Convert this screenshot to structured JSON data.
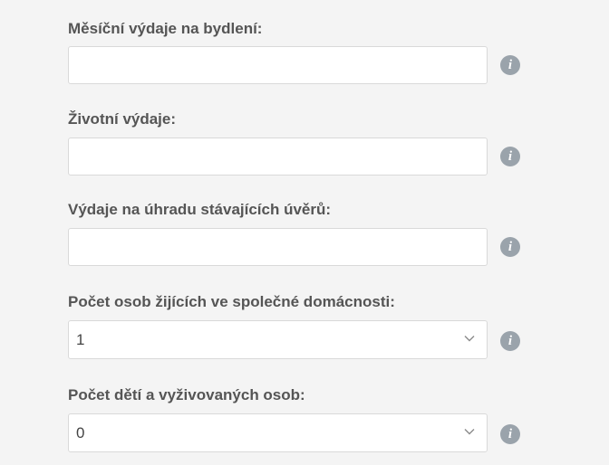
{
  "fields": [
    {
      "label": "Měsíční výdaje na bydlení:",
      "type": "text",
      "value": "",
      "info_icon": "info-icon"
    },
    {
      "label": "Životní výdaje:",
      "type": "text",
      "value": "",
      "info_icon": "info-icon"
    },
    {
      "label": "Výdaje na úhradu stávajících úvěrů:",
      "type": "text",
      "value": "",
      "info_icon": "info-icon"
    },
    {
      "label": "Počet osob žijících ve společné domácnosti:",
      "type": "select",
      "value": "1",
      "info_icon": "info-icon"
    },
    {
      "label": "Počet dětí a vyživovaných osob:",
      "type": "select",
      "value": "0",
      "info_icon": "info-icon"
    }
  ],
  "info_glyph": "i",
  "colors": {
    "background": "#f4f4f4",
    "label": "#555555",
    "input_border": "#d9d9d9",
    "info_icon": "#9aa3ab"
  }
}
